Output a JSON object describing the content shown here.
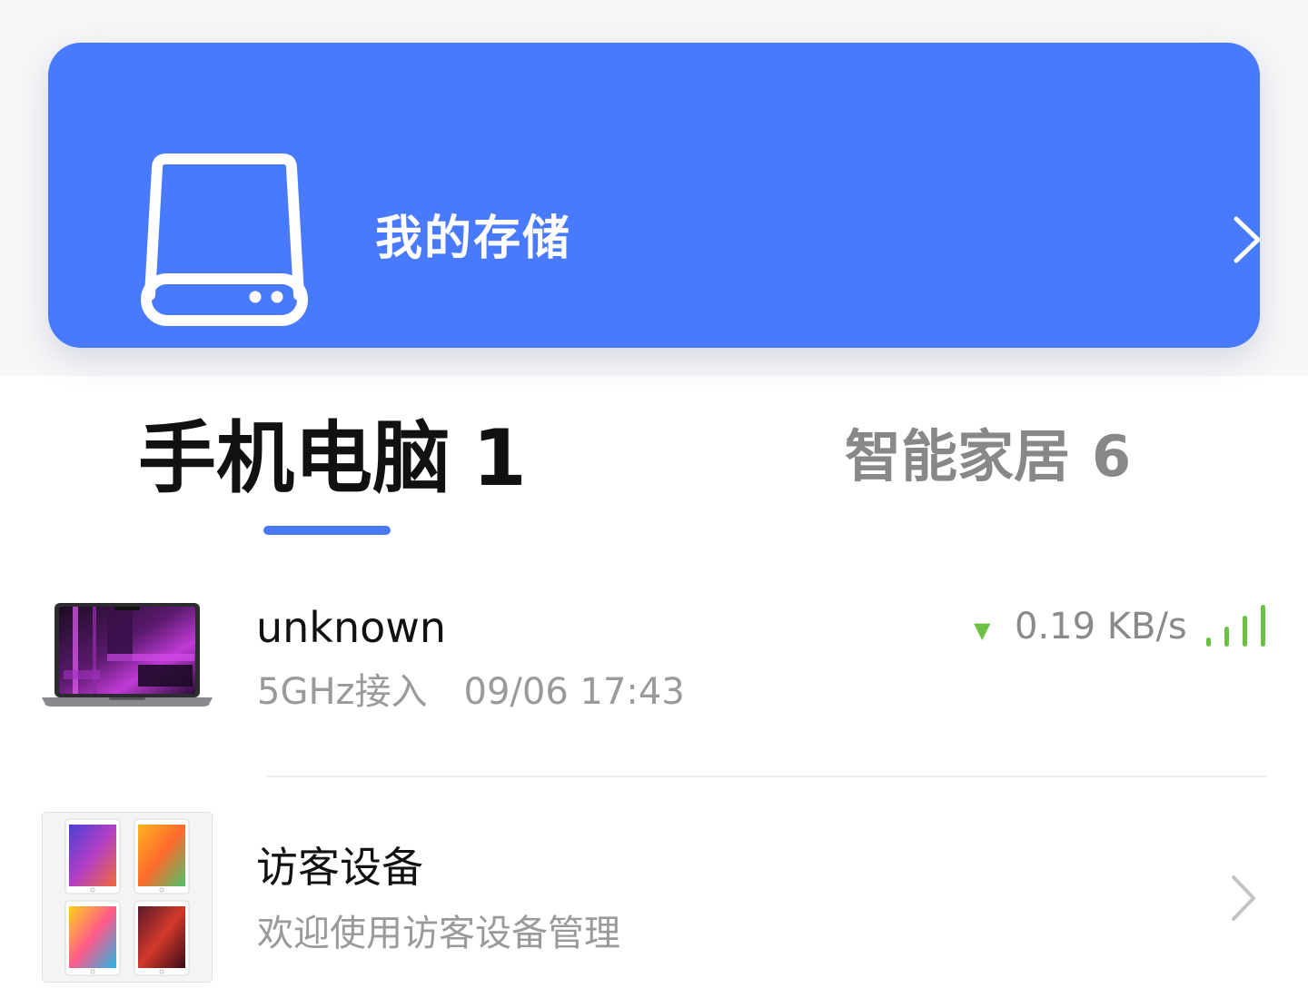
{
  "storage": {
    "title": "我的存储",
    "icon": "hard-drive-icon",
    "chevron_icon": "chevron-right-icon"
  },
  "tabs": [
    {
      "label": "手机电脑",
      "count": "1",
      "active": true
    },
    {
      "label": "智能家居",
      "count": "6",
      "active": false
    }
  ],
  "devices": [
    {
      "name": "unknown",
      "connection": "5GHz接入",
      "timestamp": "09/06 17:43",
      "speed": "0.19 KB/s",
      "speed_icon": "download-arrow-icon",
      "signal_icon": "signal-strength-icon",
      "image": "laptop-image"
    }
  ],
  "guest": {
    "title": "访客设备",
    "subtitle": "欢迎使用访客设备管理",
    "image": "guest-devices-image",
    "chevron_icon": "chevron-right-icon"
  },
  "colors": {
    "accent": "#4979fd",
    "tab_underline": "#4a78f2",
    "signal_green": "#6cc043",
    "muted_text": "#9a9a9a",
    "inactive_tab": "#888888"
  }
}
